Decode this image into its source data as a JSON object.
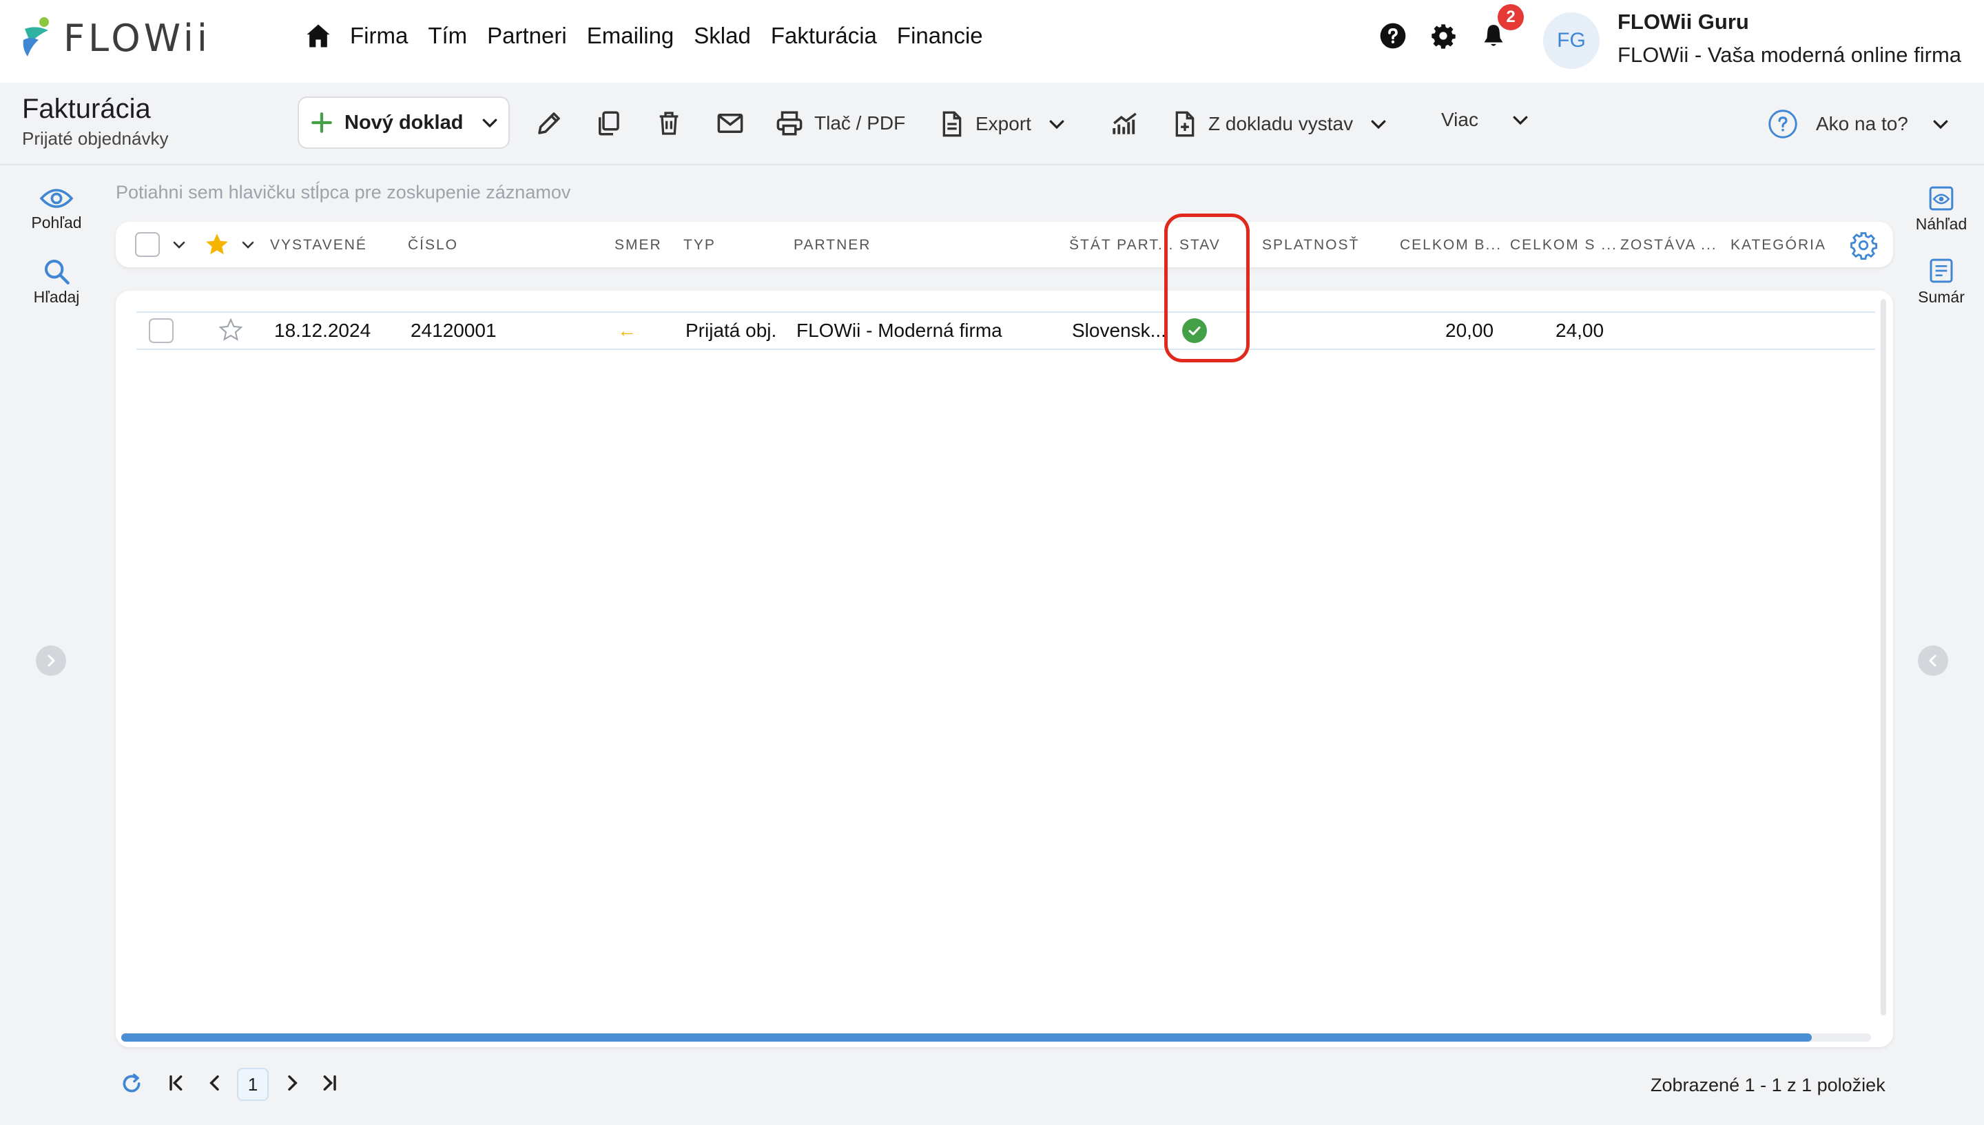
{
  "brand": {
    "name": "FLOWii"
  },
  "nav": {
    "items": [
      "Firma",
      "Tím",
      "Partneri",
      "Emailing",
      "Sklad",
      "Fakturácia",
      "Financie"
    ]
  },
  "notifications": {
    "count": "2"
  },
  "user": {
    "initials": "FG",
    "name": "FLOWii Guru",
    "company": "FLOWii - Vaša moderná online firma"
  },
  "page": {
    "title": "Fakturácia",
    "subtitle": "Prijaté objednávky"
  },
  "toolbar": {
    "new_label": "Nový doklad",
    "print_label": "Tlač / PDF",
    "export_label": "Export",
    "from_doc_label": "Z dokladu vystav",
    "more_label": "Viac",
    "help_label": "Ako na to?"
  },
  "left_rail": {
    "view_label": "Pohľad",
    "search_label": "Hľadaj"
  },
  "right_rail": {
    "preview_label": "Náhľad",
    "summary_label": "Sumár"
  },
  "grid": {
    "group_hint": "Potiahni sem hlavičku stĺpca pre zoskupenie záznamov",
    "columns": [
      "VYSTAVENÉ",
      "ČÍSLO",
      "SMER",
      "TYP",
      "PARTNER",
      "ŠTÁT PART...",
      "STAV",
      "SPLATNOSŤ",
      "CELKOM B...",
      "CELKOM S ...",
      "ZOSTÁVA ...",
      "KATEGÓRIA"
    ],
    "rows": [
      {
        "issued": "18.12.2024",
        "number": "24120001",
        "direction": "←",
        "type": "Prijatá obj.",
        "partner": "FLOWii - Moderná firma",
        "country": "Slovensk...",
        "status": "paid",
        "due": "",
        "total_net": "20,00",
        "total_gross": "24,00",
        "remaining": "",
        "category": ""
      }
    ]
  },
  "pagination": {
    "current_page": "1",
    "summary": "Zobrazené 1 - 1 z 1 položiek"
  },
  "colors": {
    "accent": "#3f86d4",
    "success": "#43a047",
    "highlight": "#e0291c",
    "warning": "#f5b400"
  }
}
